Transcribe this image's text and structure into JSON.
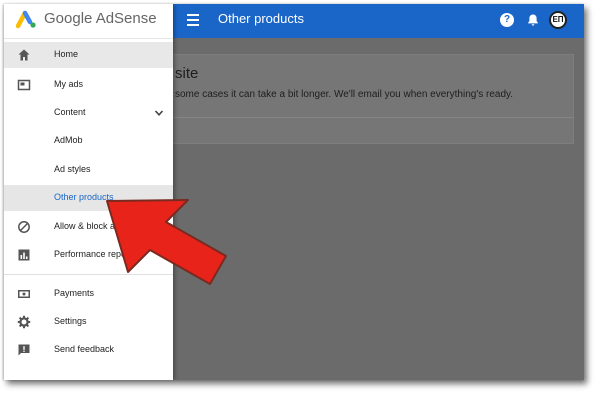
{
  "brand": {
    "name": "Google AdSense"
  },
  "topbar": {
    "title": "Other products",
    "help_glyph": "?",
    "avatar_initials": "ΕΠ"
  },
  "card": {
    "title": "site",
    "text": "some cases it can take a bit longer. We'll email you when everything's ready."
  },
  "nav": {
    "home": "Home",
    "my_ads": "My ads",
    "content": "Content",
    "admob": "AdMob",
    "ad_styles": "Ad styles",
    "other_products": "Other products",
    "allow_block": "Allow & block ads",
    "performance": "Performance reports",
    "payments": "Payments",
    "settings": "Settings",
    "send_feedback": "Send feedback"
  },
  "colors": {
    "topbar": "#1a66c8",
    "active_link": "#1a66c8",
    "arrow": "#e8231a",
    "overlay": "#6b6b6b"
  },
  "icons": {
    "home": "home-icon",
    "my_ads": "ad-box-icon",
    "allow_block": "block-icon",
    "performance": "bar-chart-icon",
    "payments": "payment-icon",
    "settings": "gear-icon",
    "send_feedback": "feedback-icon"
  }
}
